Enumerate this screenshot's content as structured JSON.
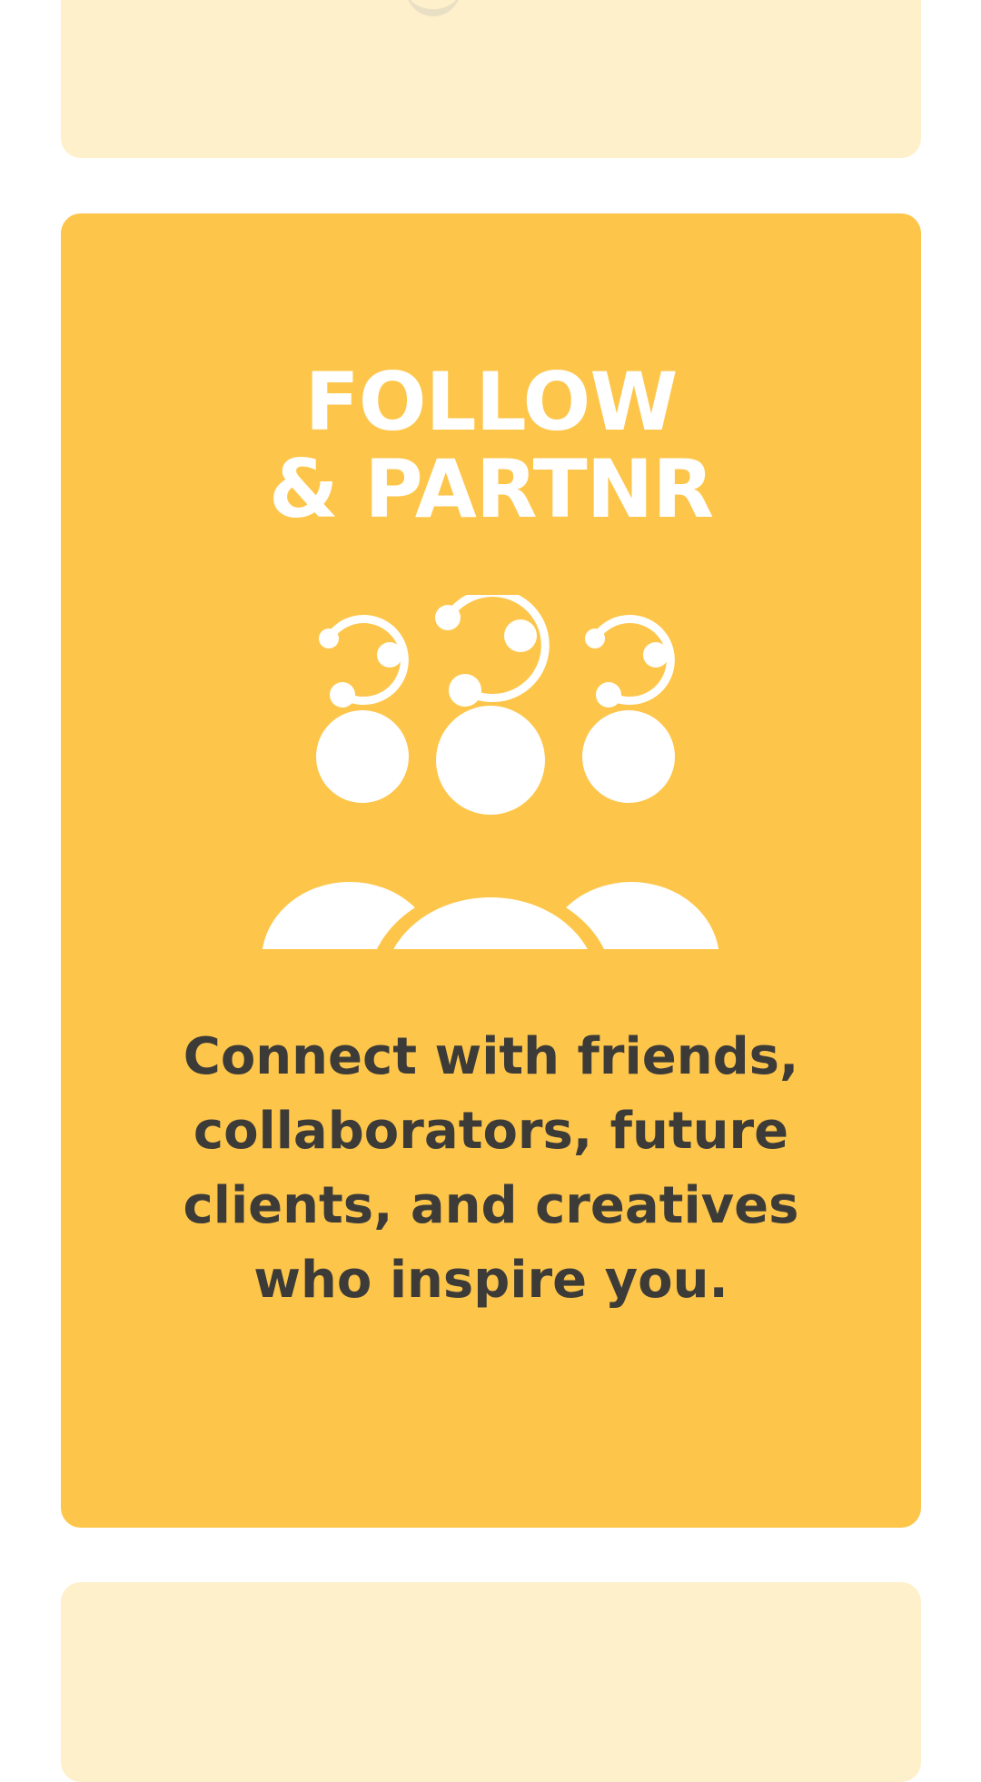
{
  "cards": [
    {
      "id": "previous",
      "background": "#FEF0CA"
    },
    {
      "id": "follow-partnr",
      "background": "#FDC64B",
      "title_line1": "FOLLOW",
      "title_line2": "& PARTNR",
      "icon": "community-network-icon",
      "description": "Connect with friends, collaborators, future clients, and creatives who inspire you."
    },
    {
      "id": "next",
      "background": "#FEF0CA"
    }
  ],
  "colors": {
    "page_background": "#FFFFFF",
    "accent": "#FDC64B",
    "accent_light": "#FEF0CA",
    "title_text": "#FFFFFF",
    "body_text": "#3D3B38"
  }
}
